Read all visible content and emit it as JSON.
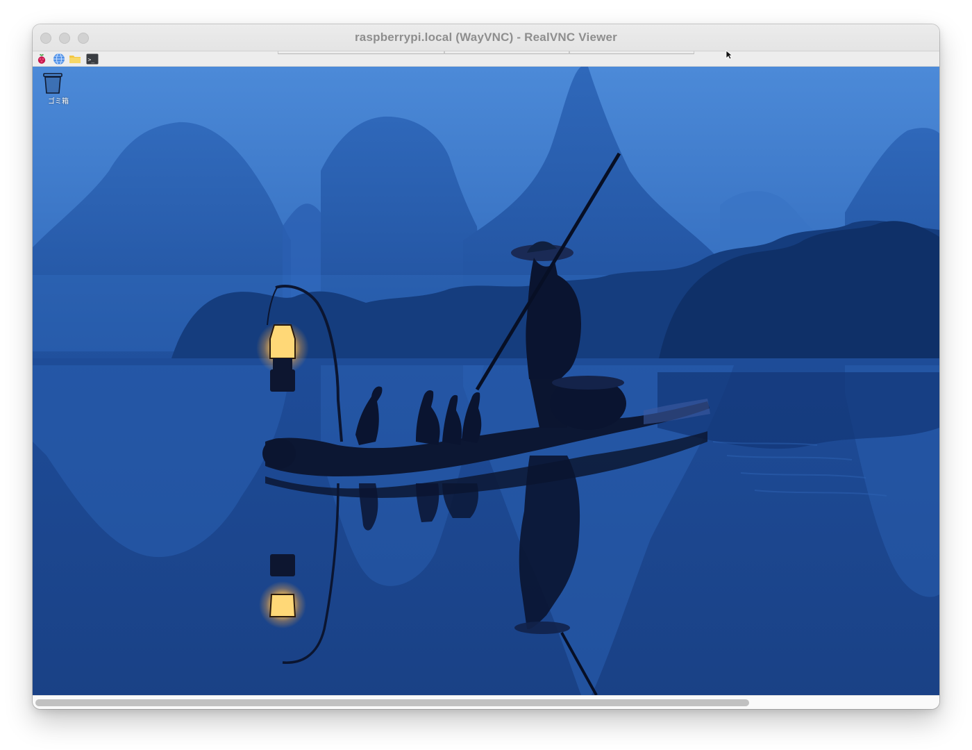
{
  "window": {
    "title": "raspberrypi.local (WayVNC) - RealVNC Viewer"
  },
  "panel": {
    "launchers": [
      "raspberry-menu-icon",
      "browser-globe-icon",
      "file-manager-folder-icon",
      "terminal-icon"
    ],
    "terminal_glyph": ">_"
  },
  "desktop": {
    "icons": [
      {
        "label": "ゴミ箱",
        "icon": "trash-icon"
      }
    ],
    "wallpaper": "fisherman-on-bamboo-raft-with-lantern-and-cormorants-misty-karst-mountains"
  },
  "colors": {
    "sky_top": "#4a88d6",
    "mist": "#2f6dbd",
    "water": "#1f4f9c",
    "lantern": "#ffd77a"
  }
}
